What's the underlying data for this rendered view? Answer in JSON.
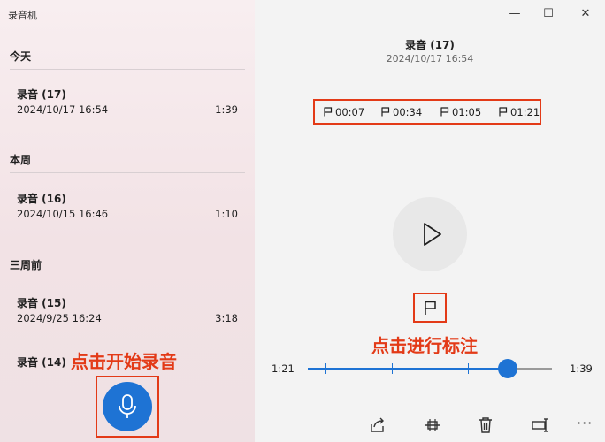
{
  "app": {
    "title": "录音机"
  },
  "sidebar": {
    "sections": [
      {
        "title": "今天",
        "items": [
          {
            "name": "录音 (17)",
            "date": "2024/10/17 16:54",
            "duration": "1:39"
          }
        ]
      },
      {
        "title": "本周",
        "items": [
          {
            "name": "录音 (16)",
            "date": "2024/10/15 16:46",
            "duration": "1:10"
          }
        ]
      },
      {
        "title": "三周前",
        "items": [
          {
            "name": "录音 (15)",
            "date": "2024/9/25 16:24",
            "duration": "3:18"
          },
          {
            "name": "录音 (14)"
          }
        ]
      }
    ],
    "annotation": "点击开始录音"
  },
  "window": {
    "minimize": "—",
    "maximize": "☐",
    "close": "✕"
  },
  "player": {
    "title": "录音 (17)",
    "date": "2024/10/17 16:54",
    "markers": [
      "00:07",
      "00:34",
      "01:05",
      "01:21"
    ],
    "annotation": "点击进行标注",
    "current_time": "1:21",
    "total_time": "1:39",
    "progress": 0.818,
    "marker_positions": [
      0.071,
      0.343,
      0.657,
      0.818
    ]
  },
  "toolbar": {
    "icons": [
      "share-icon",
      "trim-icon",
      "delete-icon",
      "rename-icon"
    ],
    "more": "···"
  },
  "colors": {
    "accent": "#1e73d4",
    "annotation": "#e33a17"
  }
}
